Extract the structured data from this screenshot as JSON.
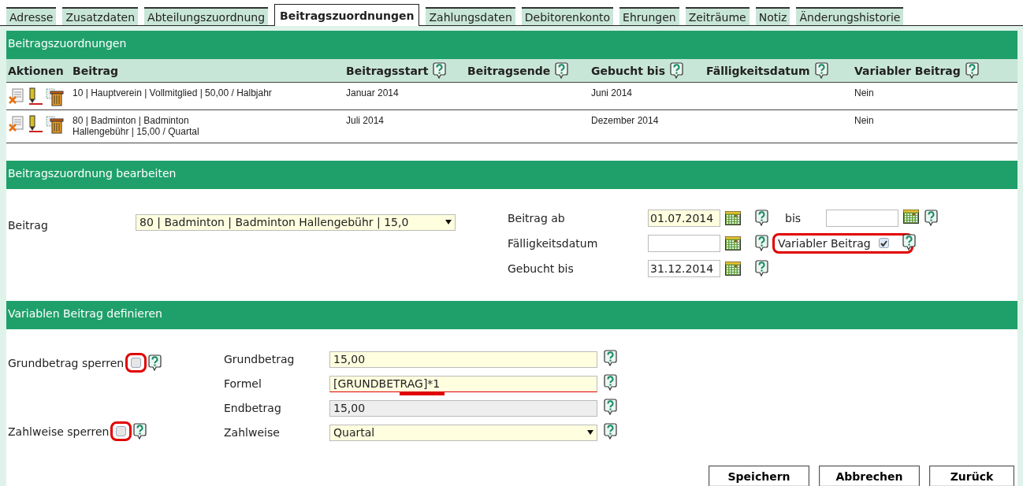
{
  "tabs": [
    {
      "label": "Adresse",
      "selected": false
    },
    {
      "label": "Zusatzdaten",
      "selected": false
    },
    {
      "label": "Abteilungszuordnung",
      "selected": false
    },
    {
      "label": "Beitragszuordnungen",
      "selected": true
    },
    {
      "label": "Zahlungsdaten",
      "selected": false
    },
    {
      "label": "Debitorenkonto",
      "selected": false
    },
    {
      "label": "Ehrungen",
      "selected": false
    },
    {
      "label": "Zeiträume",
      "selected": false
    },
    {
      "label": "Notiz",
      "selected": false
    },
    {
      "label": "Änderungshistorie",
      "selected": false
    }
  ],
  "list_section": {
    "title": "Beitragszuordnungen",
    "columns": [
      {
        "label": "Aktionen",
        "help": false
      },
      {
        "label": "Beitrag",
        "help": false
      },
      {
        "label": "Beitragsstart",
        "help": true
      },
      {
        "label": "Beitragsende",
        "help": true
      },
      {
        "label": "Gebucht bis",
        "help": true
      },
      {
        "label": "Fälligkeitsdatum",
        "help": true
      },
      {
        "label": "Variabler Beitrag",
        "help": true
      }
    ],
    "rows": [
      {
        "beitrag": [
          "10 | Hauptverein | Vollmitglied | 50,00 / Halbjahr"
        ],
        "beitragsstart": "Januar 2014",
        "gebucht_bis": "Juni 2014",
        "variabler_beitrag": "Nein"
      },
      {
        "beitrag": [
          "80 | Badminton | Badminton",
          "Hallengebühr | 15,00 / Quartal"
        ],
        "beitragsstart": "Juli 2014",
        "gebucht_bis": "Dezember 2014",
        "variabler_beitrag": "Nein"
      }
    ]
  },
  "edit_section": {
    "title": "Beitragszuordnung bearbeiten",
    "beitrag": {
      "label": "Beitrag",
      "value": "80 | Badminton | Badminton Hallengebühr | 15,0"
    },
    "beitrag_ab": {
      "label": "Beitrag ab",
      "value": "01.07.2014",
      "required": true
    },
    "bis": {
      "label": "bis",
      "required": false
    },
    "faelligkeitsdatum": {
      "label": "Fälligkeitsdatum",
      "required": false
    },
    "gebucht_bis": {
      "label": "Gebucht bis",
      "value": "31.12.2014",
      "required": false
    },
    "variabler_beitrag": {
      "label": "Variabler Beitrag",
      "checked": true,
      "highlighted": true
    }
  },
  "variable_section": {
    "title": "Variablen Beitrag definieren",
    "locks": [
      {
        "label": "Grundbetrag sperren",
        "checked": false,
        "highlighted": true
      },
      {
        "label": "Zahlweise sperren",
        "checked": false,
        "highlighted": true
      }
    ],
    "fields": [
      {
        "label": "Grundbetrag",
        "value": "15,00",
        "kind": "input",
        "marked": false
      },
      {
        "label": "Formel",
        "value": "[GRUNDBETRAG]*1",
        "kind": "input",
        "marked": true
      },
      {
        "label": "Endbetrag",
        "value": "15,00",
        "kind": "readonly",
        "marked": false
      },
      {
        "label": "Zahlweise",
        "value": "Quartal",
        "kind": "select",
        "marked": false
      }
    ]
  },
  "buttons": [
    "Speichern",
    "Abbrechen",
    "Zurück"
  ]
}
